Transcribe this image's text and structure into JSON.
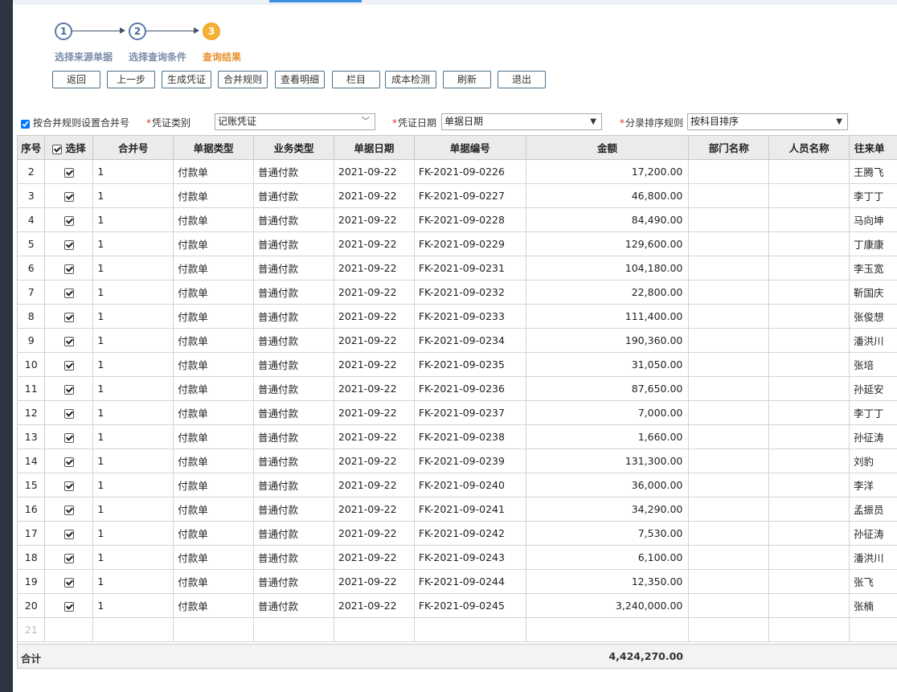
{
  "steps": [
    {
      "num": "1",
      "label": "选择来源单据"
    },
    {
      "num": "2",
      "label": "选择查询条件"
    },
    {
      "num": "3",
      "label": "查询结果"
    }
  ],
  "toolbar": [
    "返回",
    "上一步",
    "生成凭证",
    "合并规则",
    "查看明细",
    "栏目",
    "成本检测",
    "刷新",
    "退出"
  ],
  "options": {
    "merge_checkbox_label": "按合并规则设置合并号",
    "voucher_type_label": "凭证类别",
    "voucher_type_value": "记账凭证",
    "voucher_date_label": "凭证日期",
    "voucher_date_value": "单据日期",
    "sort_rule_label": "分录排序规则",
    "sort_rule_value": "按科目排序"
  },
  "columns": [
    "序号",
    "选择",
    "合并号",
    "单据类型",
    "业务类型",
    "单据日期",
    "单据编号",
    "金额",
    "部门名称",
    "人员名称",
    "往来单"
  ],
  "rows": [
    {
      "seq": "2",
      "merge": "1",
      "doc_type": "付款单",
      "biz_type": "普通付款",
      "date": "2021-09-22",
      "doc_no": "FK-2021-09-0226",
      "amount": "17,200.00",
      "dept": "",
      "person": "",
      "partner": "王腾飞"
    },
    {
      "seq": "3",
      "merge": "1",
      "doc_type": "付款单",
      "biz_type": "普通付款",
      "date": "2021-09-22",
      "doc_no": "FK-2021-09-0227",
      "amount": "46,800.00",
      "dept": "",
      "person": "",
      "partner": "李丁丁"
    },
    {
      "seq": "4",
      "merge": "1",
      "doc_type": "付款单",
      "biz_type": "普通付款",
      "date": "2021-09-22",
      "doc_no": "FK-2021-09-0228",
      "amount": "84,490.00",
      "dept": "",
      "person": "",
      "partner": "马向坤"
    },
    {
      "seq": "5",
      "merge": "1",
      "doc_type": "付款单",
      "biz_type": "普通付款",
      "date": "2021-09-22",
      "doc_no": "FK-2021-09-0229",
      "amount": "129,600.00",
      "dept": "",
      "person": "",
      "partner": "丁康康"
    },
    {
      "seq": "6",
      "merge": "1",
      "doc_type": "付款单",
      "biz_type": "普通付款",
      "date": "2021-09-22",
      "doc_no": "FK-2021-09-0231",
      "amount": "104,180.00",
      "dept": "",
      "person": "",
      "partner": "李玉宽"
    },
    {
      "seq": "7",
      "merge": "1",
      "doc_type": "付款单",
      "biz_type": "普通付款",
      "date": "2021-09-22",
      "doc_no": "FK-2021-09-0232",
      "amount": "22,800.00",
      "dept": "",
      "person": "",
      "partner": "靳国庆"
    },
    {
      "seq": "8",
      "merge": "1",
      "doc_type": "付款单",
      "biz_type": "普通付款",
      "date": "2021-09-22",
      "doc_no": "FK-2021-09-0233",
      "amount": "111,400.00",
      "dept": "",
      "person": "",
      "partner": "张俊想"
    },
    {
      "seq": "9",
      "merge": "1",
      "doc_type": "付款单",
      "biz_type": "普通付款",
      "date": "2021-09-22",
      "doc_no": "FK-2021-09-0234",
      "amount": "190,360.00",
      "dept": "",
      "person": "",
      "partner": "潘洪川"
    },
    {
      "seq": "10",
      "merge": "1",
      "doc_type": "付款单",
      "biz_type": "普通付款",
      "date": "2021-09-22",
      "doc_no": "FK-2021-09-0235",
      "amount": "31,050.00",
      "dept": "",
      "person": "",
      "partner": "张培"
    },
    {
      "seq": "11",
      "merge": "1",
      "doc_type": "付款单",
      "biz_type": "普通付款",
      "date": "2021-09-22",
      "doc_no": "FK-2021-09-0236",
      "amount": "87,650.00",
      "dept": "",
      "person": "",
      "partner": "孙延安"
    },
    {
      "seq": "12",
      "merge": "1",
      "doc_type": "付款单",
      "biz_type": "普通付款",
      "date": "2021-09-22",
      "doc_no": "FK-2021-09-0237",
      "amount": "7,000.00",
      "dept": "",
      "person": "",
      "partner": "李丁丁"
    },
    {
      "seq": "13",
      "merge": "1",
      "doc_type": "付款单",
      "biz_type": "普通付款",
      "date": "2021-09-22",
      "doc_no": "FK-2021-09-0238",
      "amount": "1,660.00",
      "dept": "",
      "person": "",
      "partner": "孙征涛"
    },
    {
      "seq": "14",
      "merge": "1",
      "doc_type": "付款单",
      "biz_type": "普通付款",
      "date": "2021-09-22",
      "doc_no": "FK-2021-09-0239",
      "amount": "131,300.00",
      "dept": "",
      "person": "",
      "partner": "刘豹"
    },
    {
      "seq": "15",
      "merge": "1",
      "doc_type": "付款单",
      "biz_type": "普通付款",
      "date": "2021-09-22",
      "doc_no": "FK-2021-09-0240",
      "amount": "36,000.00",
      "dept": "",
      "person": "",
      "partner": "李洋"
    },
    {
      "seq": "16",
      "merge": "1",
      "doc_type": "付款单",
      "biz_type": "普通付款",
      "date": "2021-09-22",
      "doc_no": "FK-2021-09-0241",
      "amount": "34,290.00",
      "dept": "",
      "person": "",
      "partner": "孟振员"
    },
    {
      "seq": "17",
      "merge": "1",
      "doc_type": "付款单",
      "biz_type": "普通付款",
      "date": "2021-09-22",
      "doc_no": "FK-2021-09-0242",
      "amount": "7,530.00",
      "dept": "",
      "person": "",
      "partner": "孙征涛"
    },
    {
      "seq": "18",
      "merge": "1",
      "doc_type": "付款单",
      "biz_type": "普通付款",
      "date": "2021-09-22",
      "doc_no": "FK-2021-09-0243",
      "amount": "6,100.00",
      "dept": "",
      "person": "",
      "partner": "潘洪川"
    },
    {
      "seq": "19",
      "merge": "1",
      "doc_type": "付款单",
      "biz_type": "普通付款",
      "date": "2021-09-22",
      "doc_no": "FK-2021-09-0244",
      "amount": "12,350.00",
      "dept": "",
      "person": "",
      "partner": "张飞"
    },
    {
      "seq": "20",
      "merge": "1",
      "doc_type": "付款单",
      "biz_type": "普通付款",
      "date": "2021-09-22",
      "doc_no": "FK-2021-09-0245",
      "amount": "3,240,000.00",
      "dept": "",
      "person": "",
      "partner": "张楠"
    }
  ],
  "empty_row_seq": "21",
  "total": {
    "label": "合计",
    "amount": "4,424,270.00"
  }
}
